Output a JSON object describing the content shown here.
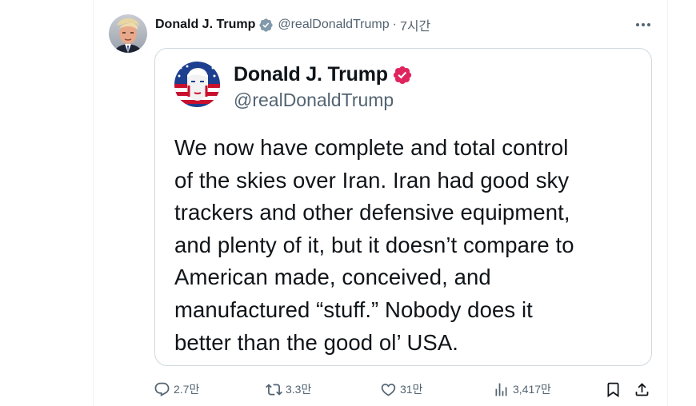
{
  "post": {
    "author_name": "Donald J. Trump",
    "author_handle": "@realDonaldTrump",
    "separator": "·",
    "time": "7시간"
  },
  "embed": {
    "author_name": "Donald J. Trump",
    "author_handle": "@realDonaldTrump",
    "body_lines": [
      "We now have complete and total control",
      "of the skies over Iran. Iran had good sky",
      "trackers and other defensive equipment,",
      "and plenty of it, but it doesn’t compare to",
      "American made, conceived, and",
      "manufactured “stuff.” Nobody does it",
      "better than the good ol’ USA."
    ]
  },
  "actions": {
    "reply_count": "2.7만",
    "repost_count": "3.3만",
    "like_count": "31만",
    "view_count": "3,417만"
  },
  "icons": {
    "more": "more-horizontal-icon",
    "verified": "verified-badge-icon",
    "reply": "reply-icon",
    "repost": "repost-icon",
    "like": "heart-icon",
    "views": "views-bar-chart-icon",
    "bookmark": "bookmark-icon",
    "share": "share-icon"
  },
  "colors": {
    "text_primary": "#0f1419",
    "text_secondary": "#536471",
    "border": "#cfd9de",
    "verified_grey": "#829aab",
    "verified_red": "#e0245e"
  }
}
